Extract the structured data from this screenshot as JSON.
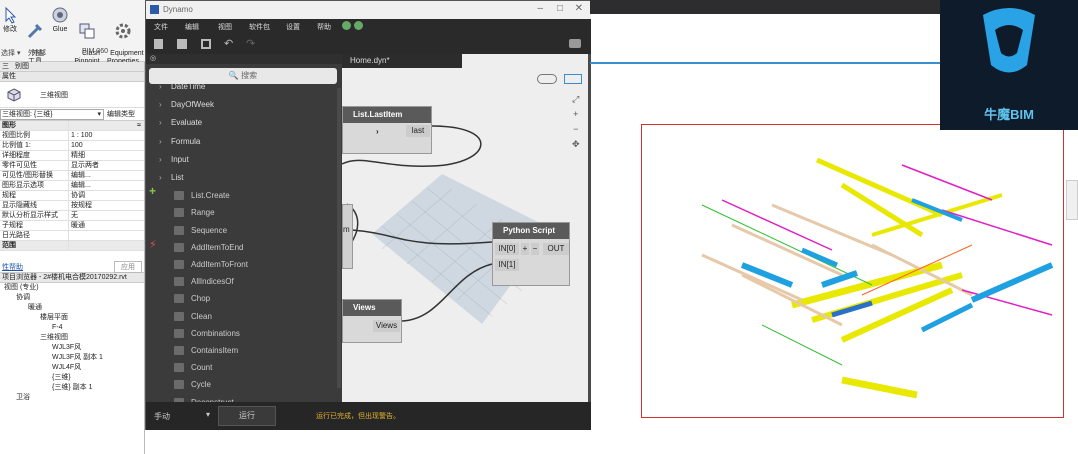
{
  "ribbon": {
    "buttons": [
      {
        "label": "修改"
      },
      {
        "label": "外部\n工具"
      },
      {
        "label": "Glue"
      },
      {
        "label": "Clash\nPinpoint"
      },
      {
        "label": "Equipment\nProperties"
      }
    ],
    "panels": [
      "选择 ▾",
      "外部",
      "BIM 360"
    ]
  },
  "properties": {
    "tabs": [
      "三",
      "别图"
    ],
    "header": "属性",
    "type_name": "三维视图",
    "selector": "三维视图: {三维}",
    "edit_type": "编辑类型",
    "section_graphics": "图形",
    "rows": [
      {
        "k": "视图比例",
        "v": "1 : 100"
      },
      {
        "k": "比例值 1:",
        "v": "100"
      },
      {
        "k": "详细程度",
        "v": "精细"
      },
      {
        "k": "零件可见性",
        "v": "显示两者"
      },
      {
        "k": "可见性/图形替换",
        "v": "编辑..."
      },
      {
        "k": "图形显示选项",
        "v": "编辑..."
      },
      {
        "k": "规程",
        "v": "协调"
      },
      {
        "k": "显示隐藏线",
        "v": "按规程"
      },
      {
        "k": "默认分析显示样式",
        "v": "无"
      },
      {
        "k": "子规程",
        "v": "暖通"
      },
      {
        "k": "日光路径",
        "v": ""
      }
    ],
    "section_extents": "范围",
    "help_link": "性帮助",
    "apply_button": "应用"
  },
  "browser": {
    "title": "项目浏览器 - 2#楼机电合模20170292.rvt",
    "items": [
      {
        "label": "视图 (专业)",
        "level": 0
      },
      {
        "label": "协调",
        "level": 1
      },
      {
        "label": "暖通",
        "level": 2
      },
      {
        "label": "楼层平面",
        "level": 3
      },
      {
        "label": "F-4",
        "level": 4
      },
      {
        "label": "三维视图",
        "level": 3
      },
      {
        "label": "WJL3F风",
        "level": 4
      },
      {
        "label": "WJL3F风 副本 1",
        "level": 4
      },
      {
        "label": "WJL4F风",
        "level": 4
      },
      {
        "label": "{三维}",
        "level": 4
      },
      {
        "label": "{三维} 副本 1",
        "level": 4
      },
      {
        "label": "卫浴",
        "level": 1
      }
    ]
  },
  "dynamo": {
    "title": "Dynamo",
    "menu": [
      "文件",
      "编辑",
      "视图",
      "软件包",
      "设置",
      "帮助"
    ],
    "search_placeholder": "🔍 搜索",
    "tab_label": "Home.dyn*",
    "library": [
      {
        "label": "DateTime",
        "type": "cat"
      },
      {
        "label": "DayOfWeek",
        "type": "cat"
      },
      {
        "label": "Evaluate",
        "type": "cat"
      },
      {
        "label": "Formula",
        "type": "cat"
      },
      {
        "label": "Input",
        "type": "cat"
      },
      {
        "label": "List",
        "type": "cat"
      },
      {
        "label": "List.Create",
        "type": "item"
      },
      {
        "label": "Range",
        "type": "item"
      },
      {
        "label": "Sequence",
        "type": "item"
      },
      {
        "label": "AddItemToEnd",
        "type": "item"
      },
      {
        "label": "AddItemToFront",
        "type": "item"
      },
      {
        "label": "AllIndicesOf",
        "type": "item"
      },
      {
        "label": "Chop",
        "type": "item"
      },
      {
        "label": "Clean",
        "type": "item"
      },
      {
        "label": "Combinations",
        "type": "item"
      },
      {
        "label": "ContainsItem",
        "type": "item"
      },
      {
        "label": "Count",
        "type": "item"
      },
      {
        "label": "Cycle",
        "type": "item"
      },
      {
        "label": "Deconstruct",
        "type": "item"
      }
    ],
    "nodes": {
      "lastitem": {
        "title": "List.LastItem",
        "out": "last"
      },
      "python": {
        "title": "Python Script",
        "in0": "IN[0]",
        "in1": "IN[1]",
        "out": "OUT"
      },
      "views": {
        "title": "Views",
        "out": "Views"
      },
      "m_port": "m"
    },
    "run_mode": "手动",
    "run_button": "运行",
    "status": "运行已完成，但出现警告。"
  },
  "logo_text": "牛魔BIM"
}
